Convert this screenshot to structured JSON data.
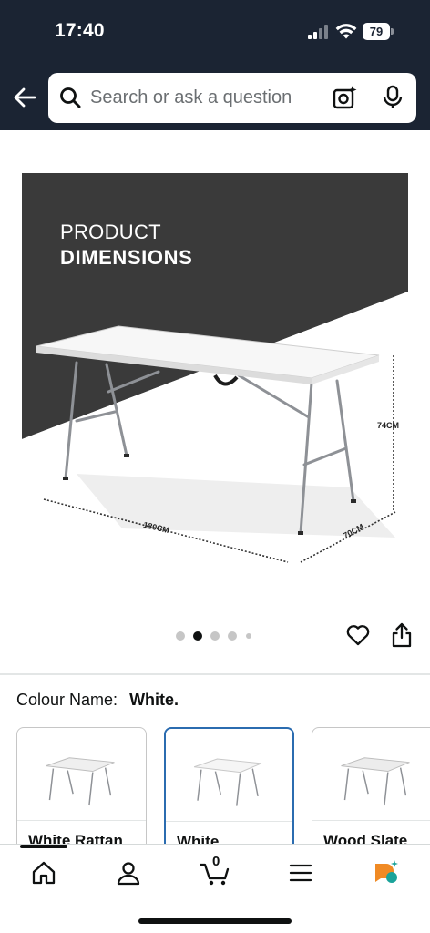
{
  "status_bar": {
    "time": "17:40",
    "battery": "79"
  },
  "search": {
    "placeholder": "Search or ask a question"
  },
  "product_image": {
    "heading_line1": "PRODUCT",
    "heading_line2": "DIMENSIONS",
    "length": "180CM",
    "width": "70CM",
    "height": "74CM"
  },
  "gallery": {
    "image_count": 5,
    "active_index": 1
  },
  "colour": {
    "label": "Colour Name:",
    "value": "White."
  },
  "swatches": [
    {
      "label": "White Rattan",
      "selected": false
    },
    {
      "label": "White",
      "selected": true
    },
    {
      "label": "Wood Slate",
      "selected": false
    }
  ],
  "cart": {
    "count": "0"
  },
  "colors": {
    "header_bg": "#1b2433",
    "selected_border": "#2b6cb0",
    "menu_accent_orange": "#f08a24",
    "menu_accent_teal": "#1aa39a"
  }
}
